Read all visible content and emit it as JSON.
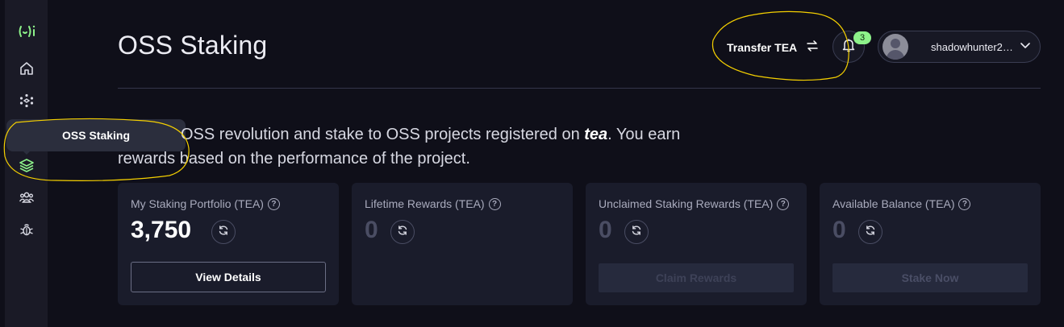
{
  "sidebar": {
    "items": [
      {
        "name": "home-icon"
      },
      {
        "name": "cube-network-icon"
      },
      {
        "name": "stack-layers-icon"
      },
      {
        "name": "users-group-icon"
      },
      {
        "name": "bug-icon"
      }
    ],
    "tooltip": "OSS Staking",
    "active_color": "#8df28a"
  },
  "header": {
    "title": "OSS Staking",
    "transfer_label": "Transfer TEA",
    "notification_count": "3",
    "username": "shadowhunter23..."
  },
  "intro": {
    "line1_prefix": "OSS revolution and stake to OSS projects registered on ",
    "brand": "tea",
    "line1_suffix": ". You earn",
    "line2": "rewards based on the performance of the project."
  },
  "cards": [
    {
      "label": "My Staking Portfolio (TEA)",
      "value": "3,750",
      "button": "View Details"
    },
    {
      "label": "Lifetime Rewards (TEA)",
      "value": "0"
    },
    {
      "label": "Unclaimed Staking Rewards (TEA)",
      "value": "0",
      "button": "Claim Rewards"
    },
    {
      "label": "Available Balance (TEA)",
      "value": "0",
      "button": "Stake Now"
    }
  ],
  "colors": {
    "background": "#0f0f19",
    "card": "#1a1c2b",
    "accent": "#8df28a",
    "annotation": "#f5d000"
  }
}
